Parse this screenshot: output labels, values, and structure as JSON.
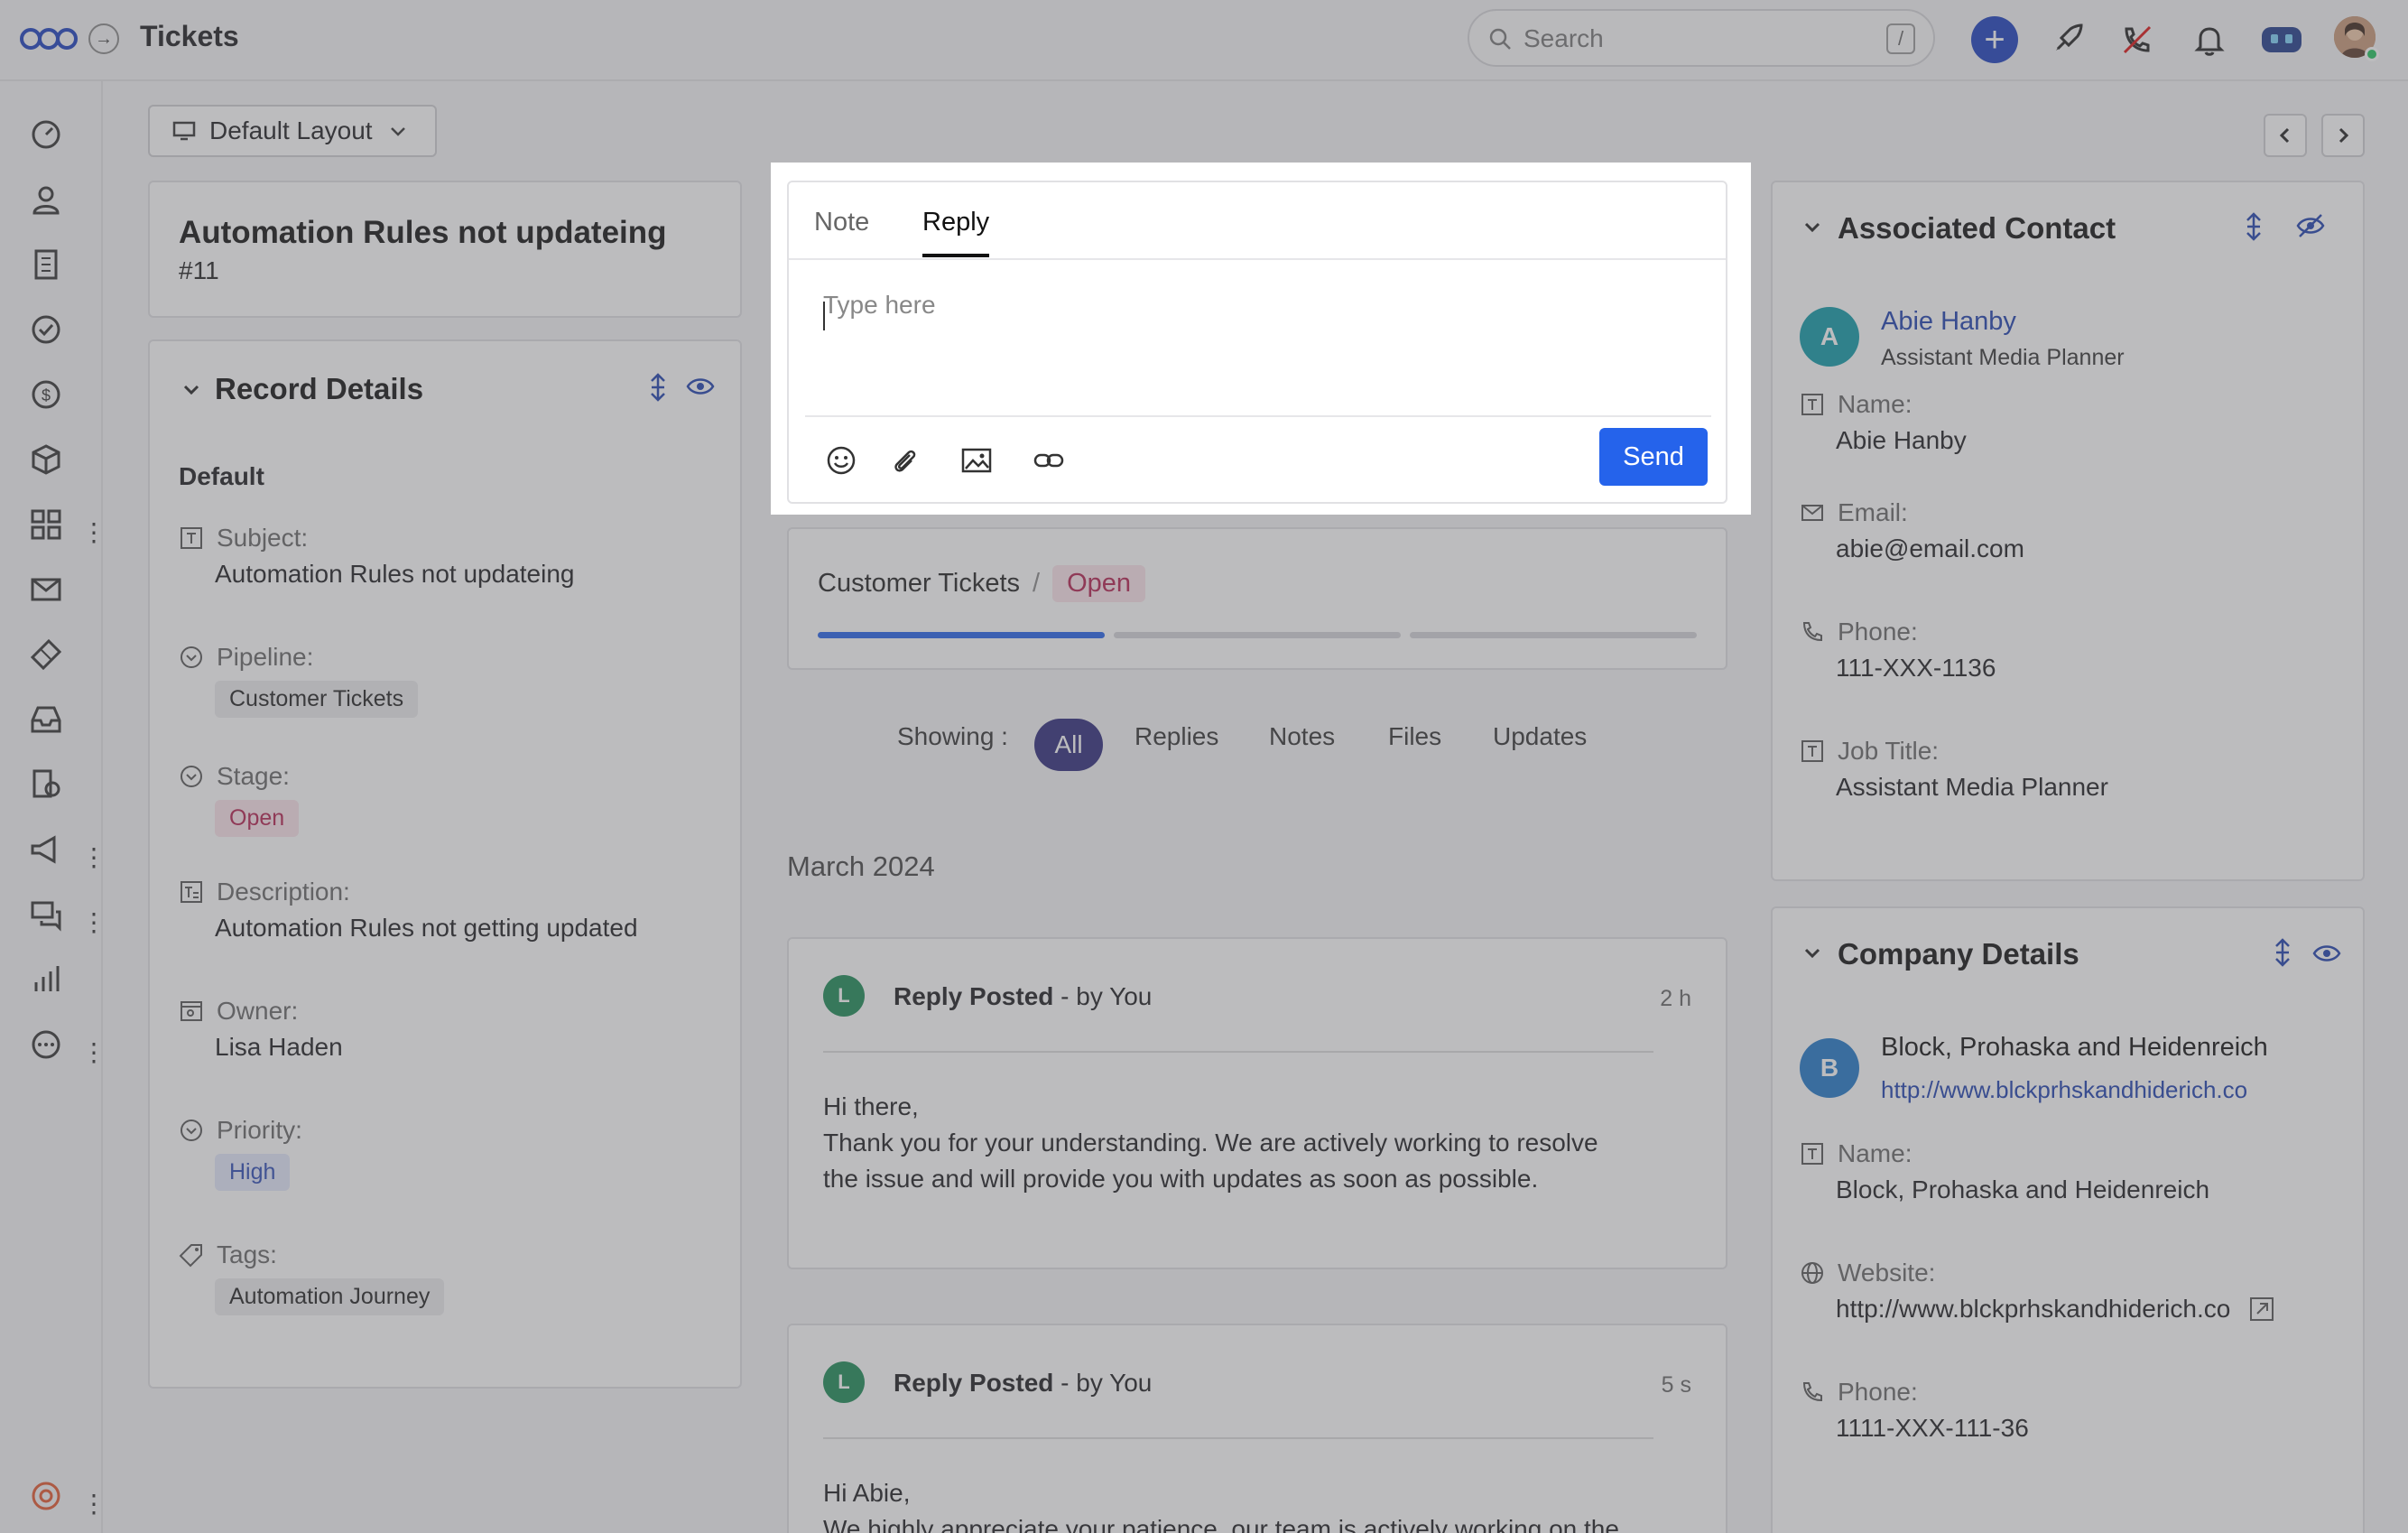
{
  "header": {
    "title": "Tickets",
    "search_placeholder": "Search",
    "search_shortcut": "/"
  },
  "toolbar": {
    "layout_label": "Default Layout"
  },
  "record": {
    "title": "Automation Rules not updateing",
    "id": "#11",
    "section_title": "Record Details",
    "group": "Default",
    "fields": {
      "subject_label": "Subject:",
      "subject_value": "Automation Rules not updateing",
      "pipeline_label": "Pipeline:",
      "pipeline_value": "Customer Tickets",
      "stage_label": "Stage:",
      "stage_value": "Open",
      "description_label": "Description:",
      "description_value": "Automation Rules not getting updated",
      "owner_label": "Owner:",
      "owner_value": "Lisa Haden",
      "priority_label": "Priority:",
      "priority_value": "High",
      "tags_label": "Tags:",
      "tags_value": "Automation Journey"
    }
  },
  "editor": {
    "tab_note": "Note",
    "tab_reply": "Reply",
    "placeholder": "Type here",
    "send_label": "Send"
  },
  "pipeline": {
    "name": "Customer Tickets",
    "separator": "/",
    "stage": "Open",
    "progress_active_segments": 1,
    "progress_total_segments": 3
  },
  "activity": {
    "showing_label": "Showing :",
    "filters": [
      "All",
      "Replies",
      "Notes",
      "Files",
      "Updates"
    ],
    "active_filter": "All",
    "month": "March 2024",
    "posts": [
      {
        "avatar": "L",
        "title": "Reply Posted",
        "by": " - by You",
        "time": "2 h",
        "lines": [
          "Hi there,",
          "Thank you for your understanding. We are actively working to resolve",
          "the issue and will provide you with updates as soon as possible."
        ]
      },
      {
        "avatar": "L",
        "title": "Reply Posted",
        "by": " - by You",
        "time": "5 s",
        "lines": [
          "Hi Abie,",
          "We highly appreciate your patience, our team is actively working on the"
        ]
      }
    ]
  },
  "contact": {
    "section_title": "Associated Contact",
    "avatar": "A",
    "name": "Abie Hanby",
    "role": "Assistant Media Planner",
    "name_label": "Name:",
    "name_value": "Abie Hanby",
    "email_label": "Email:",
    "email_value": "abie@email.com",
    "phone_label": "Phone:",
    "phone_value": "111-XXX-1136",
    "job_label": "Job Title:",
    "job_value": "Assistant Media Planner"
  },
  "company": {
    "section_title": "Company Details",
    "avatar": "B",
    "name": "Block, Prohaska and Heidenreich",
    "url": "http://www.blckprhskandhiderich.co",
    "name_label": "Name:",
    "name_value": "Block, Prohaska and Heidenreich",
    "website_label": "Website:",
    "website_value": "http://www.blckprhskandhiderich.co",
    "phone_label": "Phone:",
    "phone_value": "1111-XXX-111-36"
  },
  "colors": {
    "primary": "#2563eb",
    "accent_dark": "#2d2a7a",
    "stage_pink": "#b3204f",
    "priority_blue": "#2b4bb5",
    "avatar_green": "#1b8a55",
    "contact_avatar": "#0e9aa7",
    "company_avatar": "#1f78c9"
  }
}
